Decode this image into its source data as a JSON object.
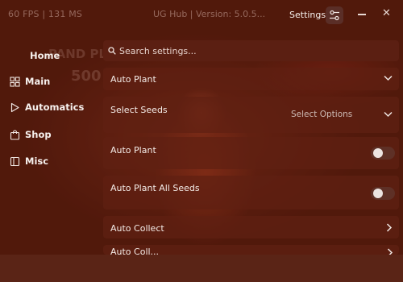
{
  "titlebar": {
    "fps": "60 FPS  |  131 MS",
    "hub_title": "UG Hub | Version: 5.0.5...",
    "settings_label": "Settings"
  },
  "background": {
    "watermark": "PAND PL",
    "number": "500"
  },
  "sidebar": {
    "items": [
      {
        "label": "Home",
        "icon": "none"
      },
      {
        "label": "Main",
        "icon": "grid-icon"
      },
      {
        "label": "Automatics",
        "icon": "play-icon"
      },
      {
        "label": "Shop",
        "icon": "shopping-bag-icon"
      },
      {
        "label": "Misc",
        "icon": "window-icon"
      }
    ],
    "selected": "Main"
  },
  "search": {
    "placeholder": "Search settings..."
  },
  "settings": [
    {
      "type": "section",
      "label": "Auto Plant"
    },
    {
      "type": "dropdown",
      "label": "Select Seeds",
      "value": "Select Options"
    },
    {
      "type": "toggle",
      "label": "Auto Plant",
      "on": false
    },
    {
      "type": "toggle",
      "label": "Auto Plant All Seeds",
      "on": false
    },
    {
      "type": "section",
      "label": "Auto Collect"
    },
    {
      "type": "section",
      "label": "Auto Coll..."
    }
  ],
  "colors": {
    "accent": "#5b1f12",
    "panel": "#431409",
    "text": "#f3ece8"
  }
}
